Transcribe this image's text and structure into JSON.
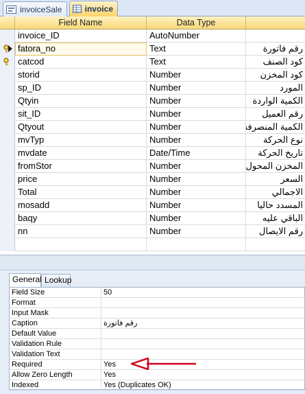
{
  "tabs": [
    {
      "label": "invoiceSale",
      "icon": "form-icon",
      "active": false
    },
    {
      "label": "invoice",
      "icon": "table-icon",
      "active": true
    }
  ],
  "grid": {
    "headers": {
      "field_name": "Field Name",
      "data_type": "Data Type",
      "description": ""
    },
    "rows": [
      {
        "name": "invoice_ID",
        "type": "AutoNumber",
        "desc": "",
        "key": false
      },
      {
        "name": "fatora_no",
        "type": "Text",
        "desc": "رقم فاتورة",
        "key": true
      },
      {
        "name": "catcod",
        "type": "Text",
        "desc": "كود الصنف",
        "key": true
      },
      {
        "name": "storid",
        "type": "Number",
        "desc": "كود المخزن",
        "key": false
      },
      {
        "name": "sp_ID",
        "type": "Number",
        "desc": "المورد",
        "key": false
      },
      {
        "name": "Qtyin",
        "type": "Number",
        "desc": "الكمية الواردة",
        "key": false
      },
      {
        "name": "sit_ID",
        "type": "Number",
        "desc": "رقم العميل",
        "key": false
      },
      {
        "name": "Qtyout",
        "type": "Number",
        "desc": "الكمية المنصرفه",
        "key": false
      },
      {
        "name": "mvTyp",
        "type": "Number",
        "desc": "نوع الحركة",
        "key": false
      },
      {
        "name": "mvdate",
        "type": "Date/Time",
        "desc": "تاريخ الحركة",
        "key": false
      },
      {
        "name": "fromStor",
        "type": "Number",
        "desc": "المخزن المحول منه",
        "key": false
      },
      {
        "name": "price",
        "type": "Number",
        "desc": "السعر",
        "key": false
      },
      {
        "name": "Total",
        "type": "Number",
        "desc": "الاجمالي",
        "key": false
      },
      {
        "name": "mosadd",
        "type": "Number",
        "desc": "المسدد حاليا",
        "key": false
      },
      {
        "name": "baqy",
        "type": "Number",
        "desc": "الباقي عليه",
        "key": false
      },
      {
        "name": "nn",
        "type": "Number",
        "desc": "رقم الايصال",
        "key": false
      }
    ],
    "selected_row": 1
  },
  "properties": {
    "tabs": {
      "general": "General",
      "lookup": "Lookup"
    },
    "rows": [
      {
        "label": "Field Size",
        "value": "50"
      },
      {
        "label": "Format",
        "value": ""
      },
      {
        "label": "Input Mask",
        "value": ""
      },
      {
        "label": "Caption",
        "value": "رقم فاتورة"
      },
      {
        "label": "Default Value",
        "value": ""
      },
      {
        "label": "Validation Rule",
        "value": ""
      },
      {
        "label": "Validation Text",
        "value": ""
      },
      {
        "label": "Required",
        "value": "Yes"
      },
      {
        "label": "Allow Zero Length",
        "value": "Yes"
      },
      {
        "label": "Indexed",
        "value": "Yes (Duplicates OK)"
      }
    ]
  },
  "colors": {
    "annotation_arrow": "#d0021b",
    "header": "#f8d978",
    "selection": "#e5c365"
  }
}
